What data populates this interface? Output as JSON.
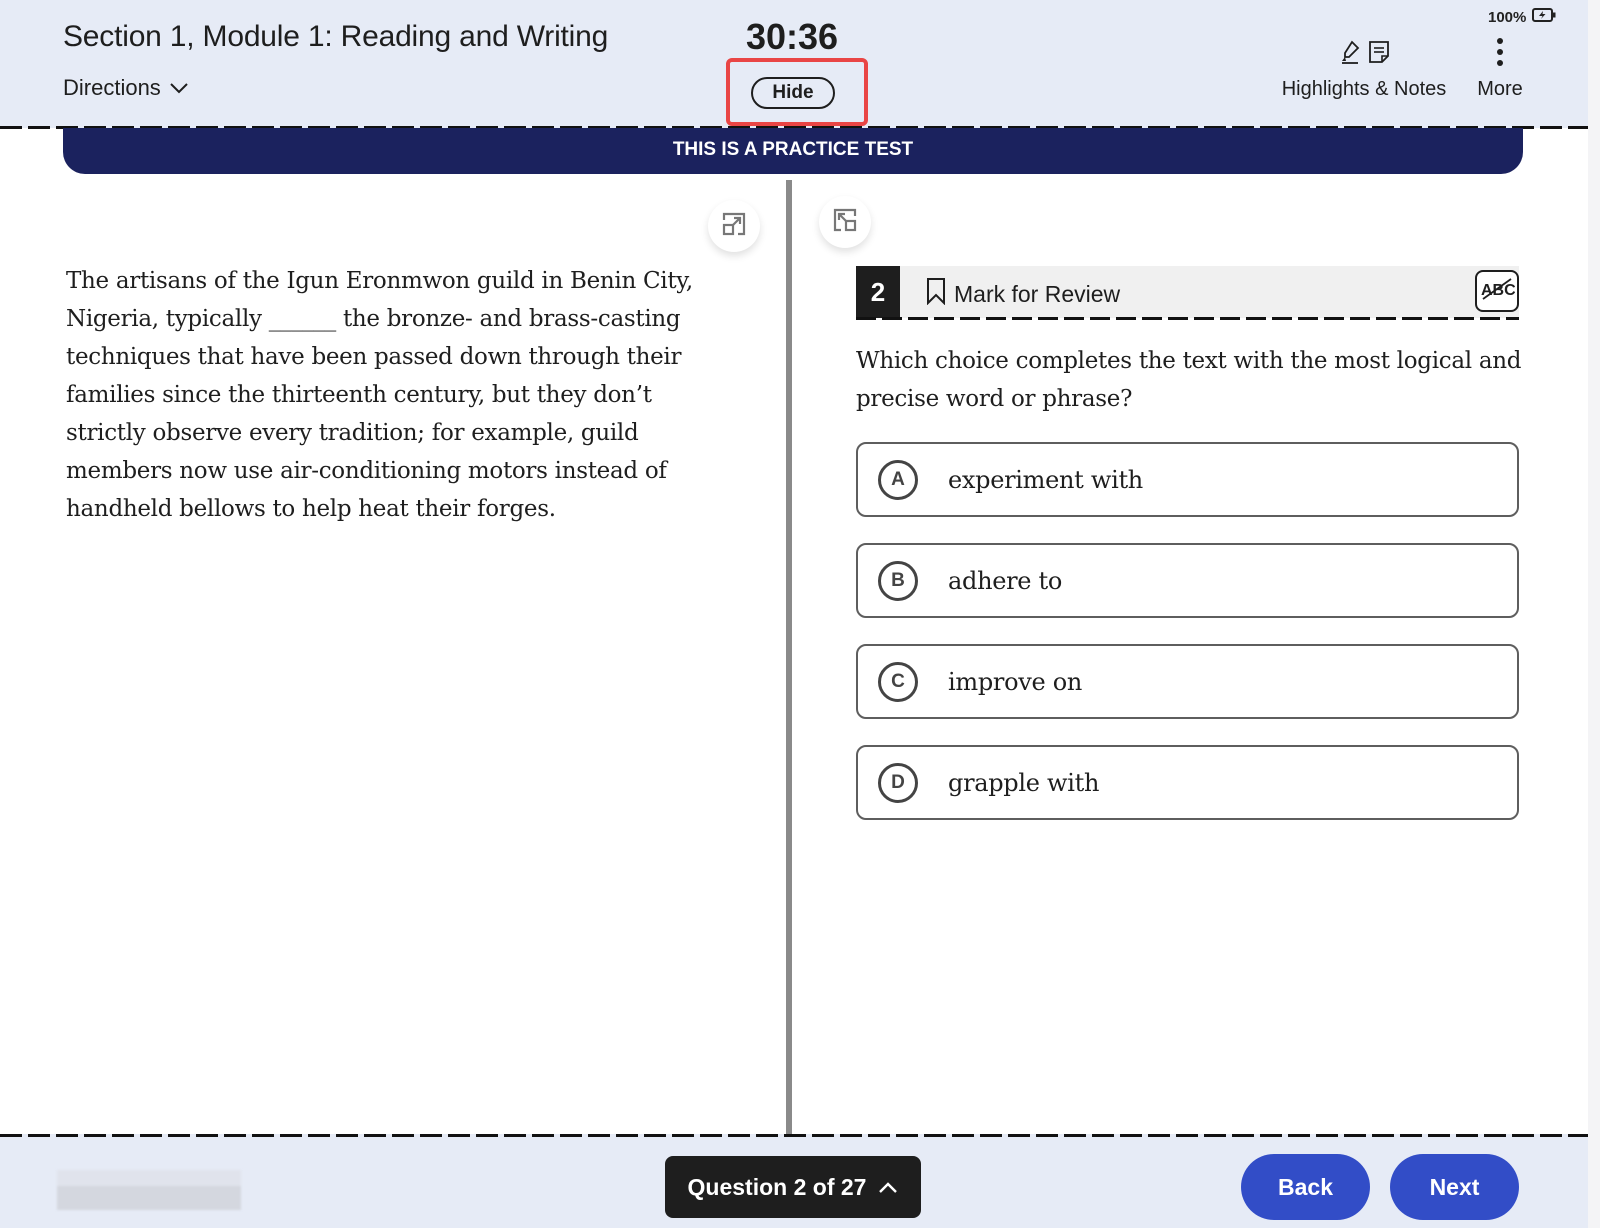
{
  "header": {
    "title": "Section 1, Module 1: Reading and Writing",
    "directions_label": "Directions",
    "timer": "30:36",
    "hide_label": "Hide",
    "battery": "100%",
    "highlights_notes_label": "Highlights & Notes",
    "more_label": "More"
  },
  "banner": {
    "text": "THIS IS A PRACTICE TEST"
  },
  "passage": {
    "text": "The artisans of the Igun Eronmwon guild in Benin City, Nigeria, typically ______ the bronze- and brass-casting techniques that have been passed down through their families since the thirteenth century, but they don’t strictly observe every tradition; for example, guild members now use air-conditioning motors instead of handheld bellows to help heat their forges."
  },
  "question": {
    "number": "2",
    "mark_for_review_label": "Mark for Review",
    "prompt": "Which choice completes the text with the most logical and precise word or phrase?",
    "choices": [
      {
        "letter": "A",
        "text": "experiment with"
      },
      {
        "letter": "B",
        "text": "adhere to"
      },
      {
        "letter": "C",
        "text": "improve on"
      },
      {
        "letter": "D",
        "text": "grapple with"
      }
    ]
  },
  "footer": {
    "question_nav_label": "Question 2 of 27",
    "back_label": "Back",
    "next_label": "Next"
  }
}
